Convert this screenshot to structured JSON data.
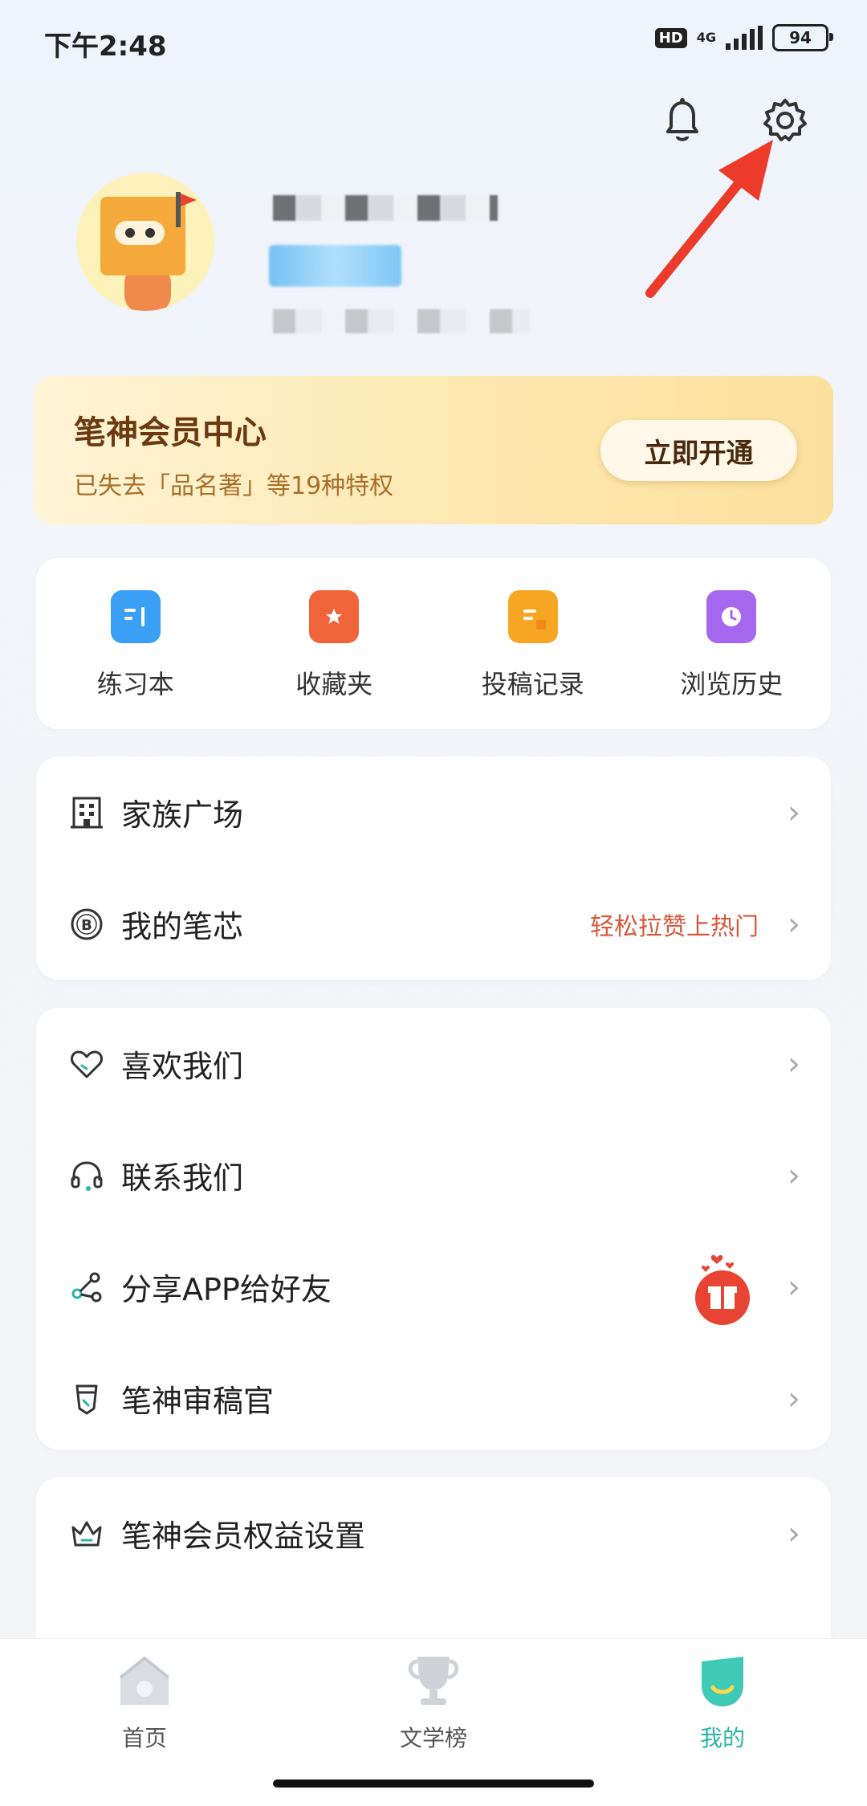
{
  "status_bar": {
    "time": "下午2:48",
    "hd": "HD",
    "network": "4G",
    "battery": "94"
  },
  "vip": {
    "title": "笔神会员中心",
    "subtitle": "已失去「品名著」等19种特权",
    "button": "立即开通"
  },
  "quick_actions": [
    {
      "label": "练习本",
      "icon": "notebook-icon",
      "color": "#3aa0f5"
    },
    {
      "label": "收藏夹",
      "icon": "bookmark-star-icon",
      "color": "#f0643a"
    },
    {
      "label": "投稿记录",
      "icon": "document-icon",
      "color": "#f6a623"
    },
    {
      "label": "浏览历史",
      "icon": "clock-icon",
      "color": "#a667ef"
    }
  ],
  "menu_group1": [
    {
      "label": "家族广场",
      "icon": "building-icon"
    },
    {
      "label": "我的笔芯",
      "icon": "coin-b-icon",
      "extra": "轻松拉赞上热门"
    }
  ],
  "menu_group2": [
    {
      "label": "喜欢我们",
      "icon": "heart-icon"
    },
    {
      "label": "联系我们",
      "icon": "headset-icon"
    },
    {
      "label": "分享APP给好友",
      "icon": "share-icon"
    },
    {
      "label": "笔神审稿官",
      "icon": "badge-icon"
    }
  ],
  "menu_group3": [
    {
      "label": "笔神会员权益设置",
      "icon": "crown-icon"
    }
  ],
  "tabs": [
    {
      "label": "首页",
      "icon": "home-icon"
    },
    {
      "label": "文学榜",
      "icon": "trophy-icon"
    },
    {
      "label": "我的",
      "icon": "profile-icon"
    }
  ],
  "colors": {
    "accent": "#f0643a",
    "vip_text": "#6b3a10",
    "highlight": "#d9583a",
    "arrow": "#ec3a2b"
  }
}
